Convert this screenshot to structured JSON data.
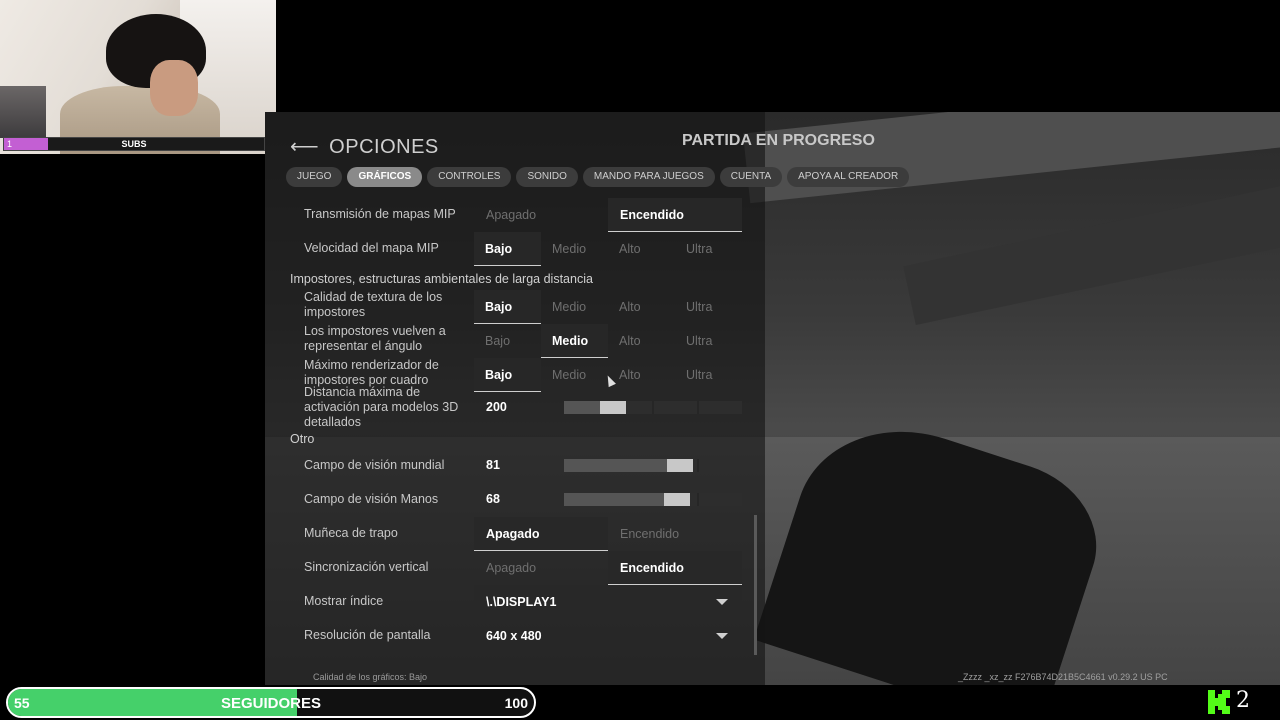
{
  "webcam": {
    "subs_count": "1",
    "subs_label": "SUBS",
    "subs_progress": 0.17,
    "subs_color": "#c35fd3"
  },
  "header": {
    "back_label": "OPCIONES",
    "status": "PARTIDA EN PROGRESO"
  },
  "tabs": [
    {
      "label": "JUEGO",
      "active": false
    },
    {
      "label": "GRÁFICOS",
      "active": true
    },
    {
      "label": "CONTROLES",
      "active": false
    },
    {
      "label": "SONIDO",
      "active": false
    },
    {
      "label": "MANDO PARA JUEGOS",
      "active": false
    },
    {
      "label": "CUENTA",
      "active": false
    },
    {
      "label": "APOYA AL CREADOR",
      "active": false
    }
  ],
  "settings": {
    "mip_stream": {
      "label": "Transmisión de mapas MIP",
      "opts": [
        "Apagado",
        "Encendido"
      ],
      "selected": "Encendido"
    },
    "mip_speed": {
      "label": "Velocidad del mapa MIP",
      "opts": [
        "Bajo",
        "Medio",
        "Alto",
        "Ultra"
      ],
      "selected": "Bajo"
    },
    "section_impostors": "Impostores, estructuras ambientales de larga distancia",
    "imp_texture": {
      "label": "Calidad de textura de los impostores",
      "opts": [
        "Bajo",
        "Medio",
        "Alto",
        "Ultra"
      ],
      "selected": "Bajo"
    },
    "imp_angle": {
      "label": "Los impostores vuelven a representar el ángulo",
      "opts": [
        "Bajo",
        "Medio",
        "Alto",
        "Ultra"
      ],
      "selected": "Medio"
    },
    "imp_max": {
      "label": "Máximo renderizador de impostores por cuadro",
      "opts": [
        "Bajo",
        "Medio",
        "Alto",
        "Ultra"
      ],
      "selected": "Bajo"
    },
    "detail_dist": {
      "label": "Distancia máxima de activación para modelos 3D detallados",
      "value": "200",
      "fraction": 0.24
    },
    "section_other": "Otro",
    "fov_world": {
      "label": "Campo de visión mundial",
      "value": "81",
      "fraction": 0.68
    },
    "fov_hands": {
      "label": "Campo de visión Manos",
      "value": "68",
      "fraction": 0.66
    },
    "ragdoll": {
      "label": "Muñeca de trapo",
      "opts": [
        "Apagado",
        "Encendido"
      ],
      "selected": "Apagado"
    },
    "vsync": {
      "label": "Sincronización vertical",
      "opts": [
        "Apagado",
        "Encendido"
      ],
      "selected": "Encendido"
    },
    "display_index": {
      "label": "Mostrar índice",
      "value": "\\.\\DISPLAY1"
    },
    "resolution": {
      "label": "Resolución de pantalla",
      "value": "640 x 480"
    }
  },
  "footer": {
    "quality": "Calidad de los gráficos: Bajo",
    "build": "_Zzzz _xz_zz F276B74D21B5C4661 v0.29.2 US PC"
  },
  "followers": {
    "current": "55",
    "label": "SEGUIDORES",
    "goal": "100",
    "progress": 0.55,
    "color": "#45d06a"
  },
  "kick": {
    "icon": "kick-logo-icon",
    "count": "2",
    "color": "#53fc18"
  }
}
